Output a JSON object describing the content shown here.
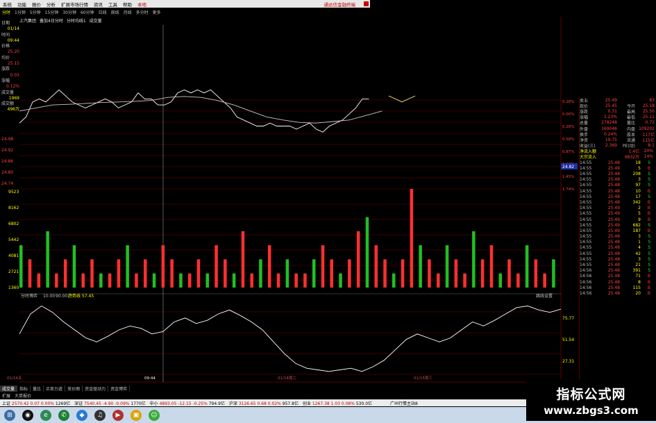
{
  "menubar": {
    "items": [
      "系统",
      "功能",
      "报价",
      "分析",
      "扩展市场行情",
      "资讯",
      "工具",
      "帮助"
    ],
    "extra": "本地",
    "title": "通达信金融终端"
  },
  "period_tabs": [
    {
      "label": "分时",
      "active": true
    },
    {
      "label": "1分钟",
      "active": false
    },
    {
      "label": "5分钟",
      "active": false
    },
    {
      "label": "15分钟",
      "active": false
    },
    {
      "label": "30分钟",
      "active": false
    },
    {
      "label": "60分钟",
      "active": false
    },
    {
      "label": "日线",
      "active": false
    },
    {
      "label": "周线",
      "active": false
    },
    {
      "label": "月线",
      "active": false
    },
    {
      "label": "多分时",
      "active": false
    },
    {
      "label": "更多",
      "active": false
    }
  ],
  "chart_header": [
    "上汽集团",
    "叠加4日分时",
    "分时均线1",
    "成交量"
  ],
  "left_info": [
    {
      "label": "日期",
      "value": "01/14",
      "cls": ""
    },
    {
      "label": "时间",
      "value": "09:44",
      "cls": ""
    },
    {
      "label": "价格",
      "value": "25.20",
      "cls": "red"
    },
    {
      "label": "均价",
      "value": "25.15",
      "cls": "red"
    },
    {
      "label": "涨跌",
      "value": "0.03",
      "cls": "red"
    },
    {
      "label": "涨幅",
      "value": "0.12%",
      "cls": "red"
    },
    {
      "label": "成交量",
      "value": "1969",
      "cls": ""
    },
    {
      "label": "成交额",
      "value": "496万",
      "cls": ""
    }
  ],
  "price_axis_left": [
    "24.98",
    "24.92",
    "24.86",
    "24.80",
    "24.74"
  ],
  "price_axis_right": [
    "0.28%",
    "0.00%",
    "0.28%",
    "0.58%",
    "0.87%",
    "1.16%",
    "1.45%",
    "1.74%"
  ],
  "current_price_tag": "24.82",
  "volume_axis": [
    "9523",
    "8162",
    "6802",
    "5442",
    "4081",
    "2721",
    "1360"
  ],
  "indicator_header": {
    "name": "分时博弈",
    "p1": "10.00",
    "p2": "90.00",
    "label": "趋势线",
    "value": "57.45"
  },
  "indicator_axis": [
    "75.77",
    "51.54",
    "27.31"
  ],
  "indicator_toolbar": "跳线设置",
  "time_axis": [
    "01/14五",
    "09:44",
    "01/14周二",
    "01/15周三"
  ],
  "quote": {
    "rows": [
      {
        "l1": "卖五",
        "v1": "25.49",
        "l2": "",
        "v2": "83"
      },
      {
        "l1": "现价",
        "v1": "25.45",
        "l2": "今开",
        "v2": "25.18"
      },
      {
        "l1": "涨跌",
        "v1": "0.31",
        "l2": "最高",
        "v2": "25.50"
      },
      {
        "l1": "涨幅",
        "v1": "1.23%",
        "l2": "最低",
        "v2": "25.11"
      },
      {
        "l1": "总量",
        "v1": "278248",
        "l2": "量比",
        "v2": "0.73"
      },
      {
        "l1": "外盘",
        "v1": "169046",
        "l2": "内盘",
        "v2": "109202"
      },
      {
        "l1": "换手",
        "v1": "0.24%",
        "l2": "股本",
        "v2": "117亿"
      },
      {
        "l1": "净资",
        "v1": "19.75",
        "l2": "流通",
        "v2": "115亿"
      },
      {
        "l1": "收益(三)",
        "v1": "2.369",
        "l2": "PE(动)",
        "v2": "8.1"
      }
    ],
    "flows": [
      {
        "label": "净流入额",
        "value": "1.4亿",
        "pct": "20%"
      },
      {
        "label": "大宗流入",
        "value": "9832万",
        "pct": "14%"
      }
    ]
  },
  "ticks": [
    {
      "t": "14:55",
      "p": "25.48",
      "v": "18",
      "bs": "S"
    },
    {
      "t": "14:55",
      "p": "25.49",
      "v": "5",
      "bs": "B"
    },
    {
      "t": "14:55",
      "p": "25.48",
      "v": "208",
      "bs": "S"
    },
    {
      "t": "14:55",
      "p": "25.48",
      "v": "3",
      "bs": "S"
    },
    {
      "t": "14:55",
      "p": "25.48",
      "v": "97",
      "bs": "S"
    },
    {
      "t": "14:55",
      "p": "25.48",
      "v": "10",
      "bs": "B"
    },
    {
      "t": "14:55",
      "p": "25.48",
      "v": "17",
      "bs": "S"
    },
    {
      "t": "14:55",
      "p": "25.48",
      "v": "342",
      "bs": "B"
    },
    {
      "t": "14:55",
      "p": "25.49",
      "v": "2",
      "bs": "B"
    },
    {
      "t": "14:55",
      "p": "25.49",
      "v": "5",
      "bs": "B"
    },
    {
      "t": "14:55",
      "p": "25.49",
      "v": "9",
      "bs": "B"
    },
    {
      "t": "14:55",
      "p": "25.49",
      "v": "682",
      "bs": "S"
    },
    {
      "t": "14:55",
      "p": "25.49",
      "v": "187",
      "bs": "B"
    },
    {
      "t": "14:55",
      "p": "25.48",
      "v": "3",
      "bs": "S"
    },
    {
      "t": "14:55",
      "p": "25.48",
      "v": "1",
      "bs": "S"
    },
    {
      "t": "14:55",
      "p": "25.48",
      "v": "4",
      "bs": "S"
    },
    {
      "t": "14:55",
      "p": "25.48",
      "v": "42",
      "bs": "S"
    },
    {
      "t": "14:55",
      "p": "25.48",
      "v": "3",
      "bs": "S"
    },
    {
      "t": "14:55",
      "p": "25.48",
      "v": "21",
      "bs": "S"
    },
    {
      "t": "14:56",
      "p": "25.48",
      "v": "391",
      "bs": "S"
    },
    {
      "t": "14:56",
      "p": "25.48",
      "v": "71",
      "bs": "B"
    },
    {
      "t": "14:56",
      "p": "25.48",
      "v": "8",
      "bs": "B"
    },
    {
      "t": "14:56",
      "p": "25.48",
      "v": "115",
      "bs": "B"
    },
    {
      "t": "14:56",
      "p": "25.48",
      "v": "20",
      "bs": "B"
    }
  ],
  "indicator_tabs": [
    {
      "label": "成交量",
      "active": true
    },
    {
      "label": "指标",
      "active": false
    },
    {
      "label": "量比",
      "active": false
    },
    {
      "label": "买卖力道",
      "active": false
    },
    {
      "label": "竞价图",
      "active": false
    },
    {
      "label": "资金驱动力",
      "active": false
    },
    {
      "label": "资金博弈",
      "active": false
    }
  ],
  "subtabs": [
    "扩展",
    "大单报价"
  ],
  "statusbar": [
    {
      "name": "上证",
      "price": "2570.42",
      "chg": "0.07",
      "pct": "0.00%",
      "amt": "1269亿"
    },
    {
      "name": "深证",
      "price": "7540.45",
      "chg": "-4.90",
      "pct": "-0.09%",
      "amt": "1770亿"
    },
    {
      "name": "中小",
      "price": "4893.05",
      "chg": "-12.15",
      "pct": "-0.25%",
      "amt": "794.9亿"
    },
    {
      "name": "沪深",
      "price": "3126.65",
      "chg": "0.68",
      "pct": "0.02%",
      "amt": "957.8亿"
    },
    {
      "name": "创业",
      "price": "1267.38",
      "chg": "1.03",
      "pct": "0.08%",
      "amt": "530.0亿"
    }
  ],
  "status_right": "广州行情主站8",
  "watermark": {
    "line1": "指标公式网",
    "line2": "www.zbgs3.com"
  },
  "colors": {
    "grid": "#7a0000",
    "price_line": "#ffffff",
    "avg_line": "#c8c8c8",
    "up_bar": "#ff3030",
    "down_bar": "#20c020",
    "indicator_line": "#ffffff"
  },
  "chart_data": {
    "type": "line",
    "title": "上汽集团",
    "price": {
      "x": [
        0,
        4,
        8,
        12,
        16,
        20,
        24,
        28,
        32,
        36,
        40,
        44,
        48,
        52,
        56,
        60,
        64,
        68,
        72,
        76,
        80,
        84,
        88,
        92,
        96,
        100,
        104,
        108,
        112,
        116,
        120,
        124,
        128,
        132,
        136,
        140,
        144,
        148,
        152,
        156,
        160,
        164,
        168,
        172,
        176,
        180,
        184,
        188,
        192,
        196,
        200,
        204,
        208,
        212,
        216,
        220,
        224,
        228,
        232,
        236,
        240
      ],
      "y": [
        24.86,
        24.88,
        24.93,
        24.94,
        24.93,
        24.95,
        24.97,
        24.95,
        24.93,
        24.92,
        24.91,
        24.92,
        24.93,
        24.94,
        24.93,
        24.91,
        24.92,
        24.93,
        24.96,
        24.94,
        24.94,
        24.92,
        24.92,
        24.93,
        24.96,
        24.97,
        24.96,
        24.97,
        24.96,
        24.97,
        24.95,
        24.93,
        24.91,
        24.88,
        24.87,
        24.86,
        24.85,
        24.85,
        24.86,
        24.85,
        24.85,
        24.85,
        24.84,
        24.85,
        24.86,
        24.84,
        24.83,
        24.85,
        24.86,
        24.87,
        24.89,
        24.91,
        24.94,
        24.94,
        null,
        null,
        24.95,
        24.94,
        24.93,
        24.94,
        24.95
      ]
    },
    "avg": {
      "x": [
        0,
        10,
        20,
        30,
        40,
        50,
        60,
        70,
        80,
        90,
        100,
        110,
        120,
        130,
        140,
        150,
        160,
        170,
        180,
        190,
        200,
        210,
        220
      ],
      "y": [
        24.9,
        24.91,
        24.92,
        24.922,
        24.925,
        24.928,
        24.93,
        24.932,
        24.935,
        24.945,
        24.948,
        24.945,
        24.935,
        24.92,
        24.9,
        24.88,
        24.87,
        24.862,
        24.86,
        24.865,
        24.87,
        24.885,
        24.9
      ]
    },
    "volume": [
      4081,
      2721,
      1360,
      5442,
      1360,
      2721,
      4081,
      1360,
      2721,
      1360,
      1360,
      2721,
      4081,
      1360,
      2721,
      1360,
      4081,
      2721,
      1360,
      1360,
      2721,
      1360,
      4081,
      2721,
      1360,
      5442,
      1360,
      2721,
      4081,
      1360,
      2721,
      1360,
      1360,
      2721,
      4081,
      2721,
      1360,
      2721,
      5442,
      6802,
      4081,
      2721,
      1360,
      2721,
      9523,
      4081,
      2721,
      1360,
      4081,
      2721,
      1360,
      5442,
      2721,
      4081,
      1360,
      2721,
      1360,
      4081,
      2721,
      1360,
      2721
    ],
    "indicator": {
      "y": [
        55,
        80,
        90,
        82,
        70,
        60,
        50,
        45,
        52,
        60,
        65,
        62,
        55,
        58,
        70,
        75,
        68,
        72,
        80,
        85,
        78,
        70,
        60,
        45,
        30,
        18,
        12,
        10,
        8,
        10,
        12,
        8,
        14,
        22,
        35,
        48,
        55,
        50,
        45,
        50,
        60,
        70,
        65,
        72,
        80,
        88,
        90,
        85,
        82,
        86
      ]
    },
    "ylim": [
      24.72,
      25.01
    ],
    "grid": true
  }
}
